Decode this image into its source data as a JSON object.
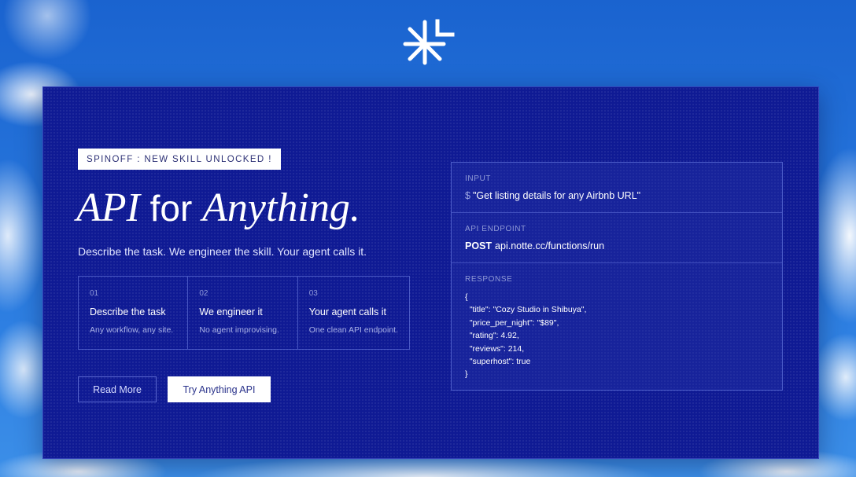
{
  "colors": {
    "card_bg": "#0f1a94",
    "sky": "#1f6fd6",
    "button_solid_bg": "#ffffff",
    "button_solid_text": "#28318a"
  },
  "header": {
    "logo_icon": "asterisk-bracket-logo-icon"
  },
  "hero": {
    "badge": "SPINOFF : NEW SKILL UNLOCKED !",
    "headline": {
      "part1": "API",
      "part2": " for ",
      "part3": "Anything."
    },
    "subtitle": "Describe the task. We engineer the skill. Your agent calls it."
  },
  "steps": [
    {
      "num": "01",
      "title": "Describe the task",
      "desc": "Any workflow, any site."
    },
    {
      "num": "02",
      "title": "We engineer it",
      "desc": "No agent improvising."
    },
    {
      "num": "03",
      "title": "Your agent calls it",
      "desc": "One clean API endpoint."
    }
  ],
  "buttons": {
    "read_more": "Read More",
    "try": "Try Anything API"
  },
  "panel": {
    "input": {
      "label": "INPUT",
      "prompt": "$",
      "value": "\"Get listing details for any Airbnb URL\""
    },
    "endpoint": {
      "label": "API ENDPOINT",
      "method": "POST",
      "url": "api.notte.cc/functions/run"
    },
    "response": {
      "label": "RESPONSE",
      "lines": [
        "{",
        "  \"title\": \"Cozy Studio in Shibuya\",",
        "  \"price_per_night\": \"$89\",",
        "  \"rating\": 4.92,",
        "  \"reviews\": 214,",
        "  \"superhost\": true",
        "}"
      ]
    }
  }
}
